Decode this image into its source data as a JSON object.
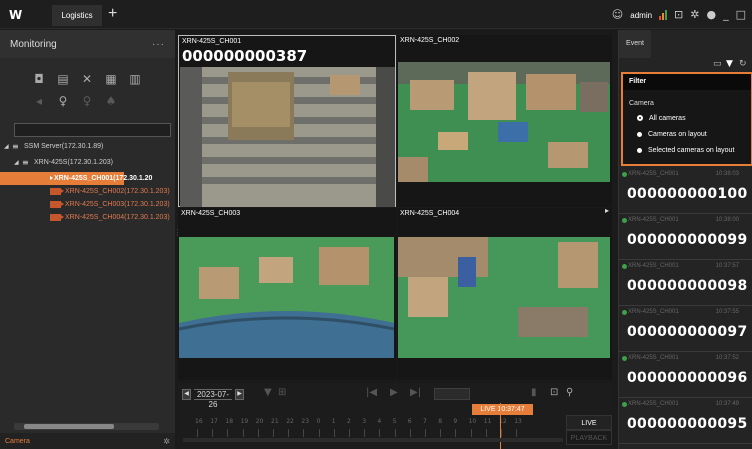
{
  "titlebar": {
    "logo": "W",
    "tab_label": "Logistics",
    "add_tab": "+",
    "user_icon": "user-circle-icon",
    "user_name": "admin",
    "bar_colors": [
      "#e24a3a",
      "#f08a24",
      "#3fa04a"
    ]
  },
  "sidebar": {
    "title": "Monitoring",
    "more": "···",
    "search_value": "",
    "tree": {
      "server": "SSM Server(172.30.1.89)",
      "device": "XRN-425S(172.30.1.203)",
      "cameras": [
        "XRN-425S_CH001(172.30.1.20",
        "XRN-425S_CH002(172.30.1.203)",
        "XRN-425S_CH003(172.30.1.203)",
        "XRN-425S_CH004(172.30.1.203)"
      ],
      "selected_index": 0
    },
    "bottom_label": "Camera"
  },
  "tiles": [
    {
      "label": "XRN-425S_CH001",
      "number": "000000000387"
    },
    {
      "label": "XRN-425S_CH002",
      "number": ""
    },
    {
      "label": "XRN-425S_CH003",
      "number": ""
    },
    {
      "label": "XRN-425S_CH004",
      "number": ""
    }
  ],
  "timeline": {
    "date": "2023-07-26",
    "live_badge": "LIVE 10:37:47",
    "hours": [
      "16",
      "17",
      "18",
      "19",
      "20",
      "21",
      "22",
      "23",
      "0",
      "1",
      "2",
      "3",
      "4",
      "5",
      "6",
      "7",
      "8",
      "9",
      "10",
      "11",
      "12",
      "13"
    ],
    "live_btn": "LIVE",
    "playback_btn": "PLAYBACK"
  },
  "event_panel": {
    "tab_label": "Event",
    "filter": {
      "title": "Filter",
      "section": "Camera",
      "options": [
        "All cameras",
        "Cameras on layout",
        "Selected cameras on layout"
      ],
      "selected": 0
    },
    "events": [
      {
        "camera": "XRN-425S_CH001",
        "time": "10:38:03",
        "number": "000000000100"
      },
      {
        "camera": "XRN-425S_CH001",
        "time": "10:38:00",
        "number": "000000000099"
      },
      {
        "camera": "XRN-425S_CH001",
        "time": "10:37:57",
        "number": "000000000098"
      },
      {
        "camera": "XRN-425S_CH001",
        "time": "10:37:55",
        "number": "000000000097"
      },
      {
        "camera": "XRN-425S_CH001",
        "time": "10:37:52",
        "number": "000000000096"
      },
      {
        "camera": "XRN-425S_CH001",
        "time": "10:37:49",
        "number": "000000000095"
      }
    ]
  }
}
